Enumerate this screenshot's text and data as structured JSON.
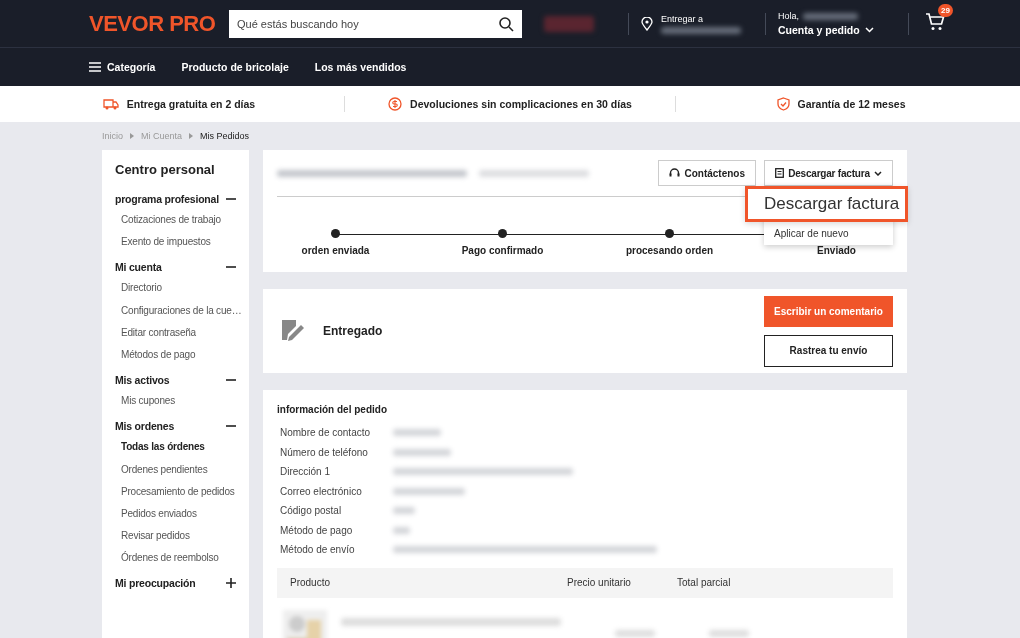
{
  "header": {
    "logo": "VEVOR PRO",
    "search": {
      "placeholder": "Qué estás buscando hoy"
    },
    "delivery_label": "Entregar a",
    "greeting": "Hola,",
    "account": "Cuenta y pedido",
    "cart_count": "29"
  },
  "nav": {
    "category": "Categoría",
    "links": [
      "Producto de bricolaje",
      "Los más vendidos"
    ]
  },
  "benefits": [
    {
      "kind": "truck",
      "text": "Entrega gratuita en 2 días"
    },
    {
      "kind": "returns",
      "text": "Devoluciones sin complicaciones en 30 días"
    },
    {
      "kind": "shield",
      "text": "Garantía de 12 meses"
    }
  ],
  "breadcrumb": [
    {
      "label": "Inicio",
      "selected": false
    },
    {
      "label": "Mi Cuenta",
      "selected": false
    },
    {
      "label": "Mis Pedidos",
      "selected": true
    }
  ],
  "sidebar": {
    "title": "Centro personal",
    "sections": [
      {
        "label": "programa profesional",
        "expanded": true,
        "items": [
          {
            "label": "Cotizaciones de trabajo",
            "selected": false
          },
          {
            "label": "Exento de impuestos",
            "selected": false
          }
        ]
      },
      {
        "label": "Mi cuenta",
        "expanded": true,
        "items": [
          {
            "label": "Directorio",
            "selected": false
          },
          {
            "label": "Configuraciones de la cue…",
            "selected": false
          },
          {
            "label": "Editar contraseña",
            "selected": false
          },
          {
            "label": "Métodos de pago",
            "selected": false
          }
        ]
      },
      {
        "label": "Mis activos",
        "expanded": true,
        "items": [
          {
            "label": "Mis cupones",
            "selected": false
          }
        ]
      },
      {
        "label": "Mis ordenes",
        "expanded": true,
        "items": [
          {
            "label": "Todas las órdenes",
            "selected": true
          },
          {
            "label": "Ordenes pendientes",
            "selected": false
          },
          {
            "label": "Procesamiento de pedidos",
            "selected": false
          },
          {
            "label": "Pedidos enviados",
            "selected": false
          },
          {
            "label": "Revisar pedidos",
            "selected": false
          },
          {
            "label": "Órdenes de reembolso",
            "selected": false
          }
        ]
      },
      {
        "label": "Mi preocupación",
        "expanded": false
      }
    ]
  },
  "order": {
    "contact_button": "Contáctenos",
    "invoice_button": "Descargar factura",
    "steps": [
      "orden enviada",
      "Pago confirmado",
      "procesando orden",
      "Enviado"
    ],
    "menu": [
      {
        "label": "Descargar factura",
        "selected": true
      },
      {
        "label": "Aplicar de nuevo",
        "selected": false
      }
    ]
  },
  "status": {
    "label": "Entregado",
    "review_button": "Escribir un comentario",
    "track_button": "Rastrea tu envío"
  },
  "info": {
    "title": "información del pedido",
    "rows": [
      "Nombre de contacto",
      "Número de teléfono",
      "Dirección 1",
      "Correo electrónico",
      "Código postal",
      "Método de pago",
      "Método de envío"
    ],
    "columns": [
      "Producto",
      "Precio unitario",
      "Total parcial"
    ]
  }
}
